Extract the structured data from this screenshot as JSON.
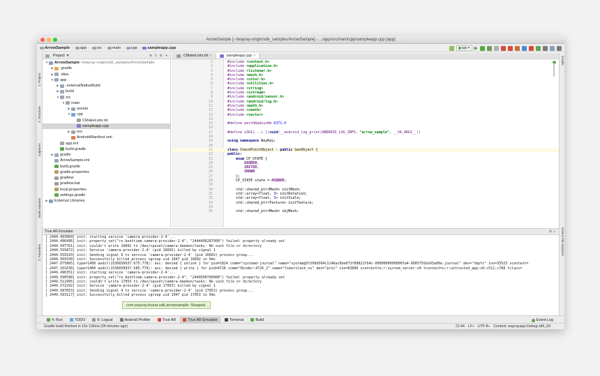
{
  "window": {
    "title": "ArrowSample [~/wayray-origin/sdk_samples/ArrowSample] - .../app/src/main/cpp/sampleapp.cpp [app]",
    "dot_colors": [
      "#fc605c",
      "#fdbc40",
      "#34c84a"
    ]
  },
  "breadcrumbs": [
    "ArrowSample",
    "app",
    "src",
    "main",
    "cpp",
    "sampleapp.cpp"
  ],
  "toolbar": {
    "config": "app"
  },
  "left_strip": [
    "1: Project",
    "2: Structure",
    "Captures",
    "Build Variants",
    "2: Favorites"
  ],
  "right_strip": [
    "Gradle",
    "Device File Explorer"
  ],
  "project": {
    "header": "Project",
    "tree": [
      {
        "label": "ArrowSample",
        "extra": " ~/wayray-origin/sdk_samples/ArrowSample",
        "depth": 0,
        "arrow": "▼",
        "icon": "#8c9fb3"
      },
      {
        "label": ".gradle",
        "depth": 1,
        "arrow": "▶",
        "icon": "#e0a95b"
      },
      {
        "label": ".idea",
        "depth": 1,
        "arrow": "▶",
        "icon": "#9aa7b4"
      },
      {
        "label": "app",
        "depth": 1,
        "arrow": "▼",
        "icon": "#9aa7b4"
      },
      {
        "label": ".externalNativeBuild",
        "depth": 2,
        "arrow": "▶",
        "icon": "#9aa7b4"
      },
      {
        "label": "build",
        "depth": 2,
        "arrow": "▶",
        "icon": "#9aa7b4"
      },
      {
        "label": "src",
        "depth": 2,
        "arrow": "▼",
        "icon": "#9aa7b4"
      },
      {
        "label": "main",
        "depth": 3,
        "arrow": "▼",
        "icon": "#9aa7b4"
      },
      {
        "label": "assets",
        "depth": 4,
        "arrow": "▶",
        "icon": "#9aa7b4"
      },
      {
        "label": "cpp",
        "depth": 4,
        "arrow": "▼",
        "icon": "#6fa5d8"
      },
      {
        "label": "CMakeLists.txt",
        "depth": 5,
        "arrow": "",
        "icon": "#9e9e9e"
      },
      {
        "label": "sampleapp.cpp",
        "depth": 5,
        "arrow": "",
        "icon": "#8077c9",
        "selected": true
      },
      {
        "label": "res",
        "depth": 4,
        "arrow": "▶",
        "icon": "#9aa7b4"
      },
      {
        "label": "AndroidManifest.xml",
        "depth": 4,
        "arrow": "",
        "icon": "#e07b53"
      },
      {
        "label": "app.iml",
        "depth": 2,
        "arrow": "",
        "icon": "#9aa7b4"
      },
      {
        "label": "build.gradle",
        "depth": 2,
        "arrow": "",
        "icon": "#5fa64d"
      },
      {
        "label": "gradle",
        "depth": 1,
        "arrow": "▶",
        "icon": "#9aa7b4"
      },
      {
        "label": "ArrowSample.iml",
        "depth": 1,
        "arrow": "",
        "icon": "#9aa7b4"
      },
      {
        "label": "build.gradle",
        "depth": 1,
        "arrow": "",
        "icon": "#5fa64d"
      },
      {
        "label": "gradle.properties",
        "depth": 1,
        "arrow": "",
        "icon": "#b0a064"
      },
      {
        "label": "gradlew",
        "depth": 1,
        "arrow": "",
        "icon": "#9e9e9e"
      },
      {
        "label": "gradlew.bat",
        "depth": 1,
        "arrow": "",
        "icon": "#9e9e9e"
      },
      {
        "label": "local.properties",
        "depth": 1,
        "arrow": "",
        "icon": "#b0a064"
      },
      {
        "label": "settings.gradle",
        "depth": 1,
        "arrow": "",
        "icon": "#5fa64d"
      },
      {
        "label": "External Libraries",
        "depth": 0,
        "arrow": "▶",
        "icon": "#8c9fb3"
      }
    ]
  },
  "editor": {
    "tabs": [
      {
        "label": "CMakeLists.txt",
        "active": false,
        "icon": "#9e9e9e"
      },
      {
        "label": "sampleapp.cpp",
        "active": true,
        "icon": "#8077c9"
      }
    ],
    "lines": [
      {
        "n": "1",
        "parts": [
          [
            "mac",
            "#include "
          ],
          [
            "str",
            "<context.h>"
          ]
        ]
      },
      {
        "n": "2",
        "parts": [
          [
            "mac",
            "#include "
          ],
          [
            "str",
            "<application.h>"
          ]
        ]
      },
      {
        "n": "3",
        "parts": [
          [
            "mac",
            "#include "
          ],
          [
            "str",
            "<listener.h>"
          ]
        ]
      },
      {
        "n": "4",
        "parts": [
          [
            "mac",
            "#include "
          ],
          [
            "str",
            "<mesh.h>"
          ]
        ]
      },
      {
        "n": "5",
        "parts": [
          [
            "mac",
            "#include "
          ],
          [
            "str",
            "<color.h>"
          ]
        ]
      },
      {
        "n": "6",
        "parts": [
          [
            "mac",
            "#include "
          ],
          [
            "str",
            "<utilities.h>"
          ]
        ]
      },
      {
        "n": "7",
        "parts": [
          [
            "mac",
            "#include "
          ],
          [
            "str",
            "<string>"
          ]
        ]
      },
      {
        "n": "8",
        "parts": [
          [
            "mac",
            "#include "
          ],
          [
            "str",
            "<sstream>"
          ]
        ]
      },
      {
        "n": "9",
        "parts": [
          [
            "mac",
            "#include "
          ],
          [
            "str",
            "<android/sensor.h>"
          ]
        ]
      },
      {
        "n": "10",
        "parts": [
          [
            "mac",
            "#include "
          ],
          [
            "str",
            "<android/log.h>"
          ]
        ]
      },
      {
        "n": "11",
        "parts": [
          [
            "mac",
            "#include "
          ],
          [
            "str",
            "<math.h>"
          ]
        ]
      },
      {
        "n": "12",
        "parts": [
          [
            "mac",
            "#include "
          ],
          [
            "str",
            "<cmath>"
          ]
        ]
      },
      {
        "n": "13",
        "parts": [
          [
            "mac",
            "#include "
          ],
          [
            "str",
            "<vector>"
          ]
        ]
      },
      {
        "n": "14",
        "parts": []
      },
      {
        "n": "15",
        "parts": [
          [
            "mac",
            "#define earthRadiusKm "
          ],
          [
            "num",
            "6371.0"
          ]
        ]
      },
      {
        "n": "16",
        "parts": []
      },
      {
        "n": "17",
        "parts": [
          [
            "mac",
            "#define LOGI(...) (("
          ],
          [
            "kw",
            "void"
          ],
          [
            "mac",
            ")__android_log_print(ANDROID_LOG_INFO, "
          ],
          [
            "str",
            "\"arrow_sample\""
          ],
          [
            "mac",
            ", __VA_ARGS__))"
          ]
        ]
      },
      {
        "n": "18",
        "parts": []
      },
      {
        "n": "19",
        "parts": [
          [
            "kw",
            "using namespace "
          ],
          [
            "txt",
            "WayRay;"
          ]
        ]
      },
      {
        "n": "20",
        "parts": []
      },
      {
        "n": "21",
        "parts": [
          [
            "kw",
            "class "
          ],
          [
            "txt",
            "CheckPointObject : "
          ],
          [
            "kw",
            "public "
          ],
          [
            "txt",
            "GeoObject {"
          ]
        ],
        "hl": true
      },
      {
        "n": "22",
        "parts": [
          [
            "kw",
            "public:"
          ]
        ]
      },
      {
        "n": "23",
        "parts": [
          [
            "txt",
            "    "
          ],
          [
            "kw",
            "enum "
          ],
          [
            "txt",
            "CP_STATE {"
          ]
        ]
      },
      {
        "n": "24",
        "parts": [
          [
            "txt",
            "        "
          ],
          [
            "enm",
            "HIDDEN,"
          ]
        ]
      },
      {
        "n": "25",
        "parts": [
          [
            "txt",
            "        "
          ],
          [
            "enm",
            "INITED,"
          ]
        ]
      },
      {
        "n": "26",
        "parts": [
          [
            "txt",
            "        "
          ],
          [
            "enm",
            "SHOWN"
          ]
        ]
      },
      {
        "n": "27",
        "parts": [
          [
            "txt",
            "    };"
          ]
        ]
      },
      {
        "n": "28",
        "parts": [
          [
            "txt",
            "    CP_STATE state = "
          ],
          [
            "enm",
            "HIDDEN"
          ],
          [
            "txt",
            ";"
          ]
        ]
      },
      {
        "n": "29",
        "parts": []
      },
      {
        "n": "30",
        "parts": [
          [
            "txt",
            "    std::shared_ptr<Mesh> initMesh;"
          ]
        ]
      },
      {
        "n": "31",
        "parts": [
          [
            "txt",
            "    std::array<float, "
          ],
          [
            "num",
            "3"
          ],
          [
            "txt",
            "> initRotation;"
          ]
        ]
      },
      {
        "n": "32",
        "parts": [
          [
            "txt",
            "    std::array<float, "
          ],
          [
            "num",
            "3"
          ],
          [
            "txt",
            "> initScale;"
          ]
        ]
      },
      {
        "n": "33",
        "parts": [
          [
            "txt",
            "    std::shared_ptr<Texture> initTexture;"
          ]
        ]
      },
      {
        "n": "34",
        "parts": []
      },
      {
        "n": "35",
        "parts": [
          [
            "txt",
            "    std::shared_ptr<Mesh> cbjMesh;"
          ]
        ]
      }
    ]
  },
  "bottom": {
    "header": "True AR Emulator",
    "log": [
      "[ 2444.493904] init: starting service 'camera-provider-2-4'...",
      "[ 2444.496496] init: property_set(\"ro.boottime.camera-provider-2-4\", \"2444496287000\") failed: property already set",
      "[ 2444.507761] init: couldn't write 16602 to /dev/cpuset/camera-daemon/tasks: No such file or directory",
      "[ 2444.555872] init: Service 'camera-provider-2-4' (pid 16602) killed by signal 1",
      "[ 2444.559193] init: Sending signal 9 to service 'camera-provider-2-4' (pid 16602) process group...",
      "[ 2444.569330] init: Successfully killed process cgroup uid 1047 pid 16602 in 0ms",
      "[ 2447.075865] type=1400 audit(1536650937.675:778): avc: denied { unlink } for pid=1824 comm=\"systemd-journal\" name=\"system@5f206b504c1146ac8be073f89821fb4c-0000000000000fa4-00057592e93a00a.journal\" dev=\"tmpfs\" ino=35523 scontext=",
      "[ 2447.101630] type=1400 audit(1536650937.585:779): avc: denied { write } for pid=4726 comm=\"Binder:4726_2\" name=\"timerslack_ns\" dev=\"proc\" ino=63866 scontext=u:r:system_server:s0 tcontext=u:r:untrusted_app:s0:c512,c768 tclass=",
      "[ 2449.496351] init: starting service 'camera-provider-2-4'...",
      "[ 2449.500590] init: property_set(\"ro.boottime.camera-provider-2-4\", \"2449500740000\") failed: property already set",
      "[ 2449.512495] init: couldn't write 17053 to /dev/cpuset/camera-daemon/tasks: No such file or directory",
      "[ 2449.572292] init: Service 'camera-provider-2-4' (pid 17053) killed by signal 1",
      "[ 2449.587053] init: Sending signal 9 to service 'camera-provider-2-4' (pid 17053) process group...",
      "[ 2449.593117] init: Successfully killed process cgroup uid 1047 pid 17053 in 0ms"
    ],
    "toast": "com.wayray.truear.sdk.arrowsample: Stopped."
  },
  "toolwindows": [
    {
      "label": "4: Run",
      "icon": "#5fa64d",
      "active": false
    },
    {
      "label": "TODO",
      "icon": "#6fa5d8",
      "active": false
    },
    {
      "label": "6: Logcat",
      "icon": "#8c9fb3",
      "active": false
    },
    {
      "label": "Android Profiler",
      "icon": "#7a7a7a",
      "active": false
    },
    {
      "label": "True AR",
      "icon": "#d9493b",
      "active": false
    },
    {
      "label": "True AR Emulator",
      "icon": "#d9493b",
      "active": true
    },
    {
      "label": "Terminal",
      "icon": "#444444",
      "active": false
    },
    {
      "label": "Build",
      "icon": "#5fa64d",
      "active": false
    }
  ],
  "event_log": "Event Log",
  "status": {
    "message": "Gradle build finished in 15s 136ms (34 minutes ago)",
    "pos": "21:44",
    "lf": "LF÷",
    "enc": "UTF-8÷",
    "ctx": "Context: wayrayapp-Debug-x86_64"
  }
}
